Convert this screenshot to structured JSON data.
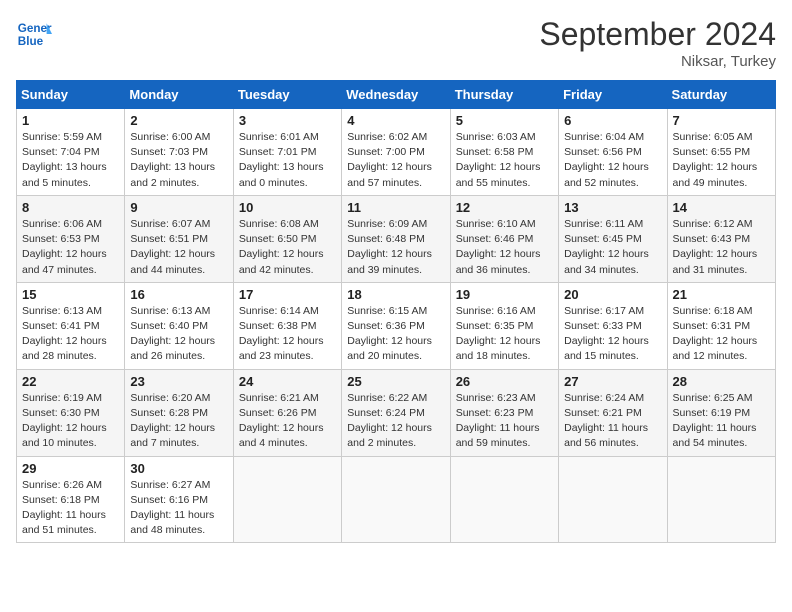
{
  "header": {
    "logo_line1": "General",
    "logo_line2": "Blue",
    "month": "September 2024",
    "location": "Niksar, Turkey"
  },
  "weekdays": [
    "Sunday",
    "Monday",
    "Tuesday",
    "Wednesday",
    "Thursday",
    "Friday",
    "Saturday"
  ],
  "weeks": [
    [
      {
        "day": "1",
        "info": "Sunrise: 5:59 AM\nSunset: 7:04 PM\nDaylight: 13 hours\nand 5 minutes."
      },
      {
        "day": "2",
        "info": "Sunrise: 6:00 AM\nSunset: 7:03 PM\nDaylight: 13 hours\nand 2 minutes."
      },
      {
        "day": "3",
        "info": "Sunrise: 6:01 AM\nSunset: 7:01 PM\nDaylight: 13 hours\nand 0 minutes."
      },
      {
        "day": "4",
        "info": "Sunrise: 6:02 AM\nSunset: 7:00 PM\nDaylight: 12 hours\nand 57 minutes."
      },
      {
        "day": "5",
        "info": "Sunrise: 6:03 AM\nSunset: 6:58 PM\nDaylight: 12 hours\nand 55 minutes."
      },
      {
        "day": "6",
        "info": "Sunrise: 6:04 AM\nSunset: 6:56 PM\nDaylight: 12 hours\nand 52 minutes."
      },
      {
        "day": "7",
        "info": "Sunrise: 6:05 AM\nSunset: 6:55 PM\nDaylight: 12 hours\nand 49 minutes."
      }
    ],
    [
      {
        "day": "8",
        "info": "Sunrise: 6:06 AM\nSunset: 6:53 PM\nDaylight: 12 hours\nand 47 minutes."
      },
      {
        "day": "9",
        "info": "Sunrise: 6:07 AM\nSunset: 6:51 PM\nDaylight: 12 hours\nand 44 minutes."
      },
      {
        "day": "10",
        "info": "Sunrise: 6:08 AM\nSunset: 6:50 PM\nDaylight: 12 hours\nand 42 minutes."
      },
      {
        "day": "11",
        "info": "Sunrise: 6:09 AM\nSunset: 6:48 PM\nDaylight: 12 hours\nand 39 minutes."
      },
      {
        "day": "12",
        "info": "Sunrise: 6:10 AM\nSunset: 6:46 PM\nDaylight: 12 hours\nand 36 minutes."
      },
      {
        "day": "13",
        "info": "Sunrise: 6:11 AM\nSunset: 6:45 PM\nDaylight: 12 hours\nand 34 minutes."
      },
      {
        "day": "14",
        "info": "Sunrise: 6:12 AM\nSunset: 6:43 PM\nDaylight: 12 hours\nand 31 minutes."
      }
    ],
    [
      {
        "day": "15",
        "info": "Sunrise: 6:13 AM\nSunset: 6:41 PM\nDaylight: 12 hours\nand 28 minutes."
      },
      {
        "day": "16",
        "info": "Sunrise: 6:13 AM\nSunset: 6:40 PM\nDaylight: 12 hours\nand 26 minutes."
      },
      {
        "day": "17",
        "info": "Sunrise: 6:14 AM\nSunset: 6:38 PM\nDaylight: 12 hours\nand 23 minutes."
      },
      {
        "day": "18",
        "info": "Sunrise: 6:15 AM\nSunset: 6:36 PM\nDaylight: 12 hours\nand 20 minutes."
      },
      {
        "day": "19",
        "info": "Sunrise: 6:16 AM\nSunset: 6:35 PM\nDaylight: 12 hours\nand 18 minutes."
      },
      {
        "day": "20",
        "info": "Sunrise: 6:17 AM\nSunset: 6:33 PM\nDaylight: 12 hours\nand 15 minutes."
      },
      {
        "day": "21",
        "info": "Sunrise: 6:18 AM\nSunset: 6:31 PM\nDaylight: 12 hours\nand 12 minutes."
      }
    ],
    [
      {
        "day": "22",
        "info": "Sunrise: 6:19 AM\nSunset: 6:30 PM\nDaylight: 12 hours\nand 10 minutes."
      },
      {
        "day": "23",
        "info": "Sunrise: 6:20 AM\nSunset: 6:28 PM\nDaylight: 12 hours\nand 7 minutes."
      },
      {
        "day": "24",
        "info": "Sunrise: 6:21 AM\nSunset: 6:26 PM\nDaylight: 12 hours\nand 4 minutes."
      },
      {
        "day": "25",
        "info": "Sunrise: 6:22 AM\nSunset: 6:24 PM\nDaylight: 12 hours\nand 2 minutes."
      },
      {
        "day": "26",
        "info": "Sunrise: 6:23 AM\nSunset: 6:23 PM\nDaylight: 11 hours\nand 59 minutes."
      },
      {
        "day": "27",
        "info": "Sunrise: 6:24 AM\nSunset: 6:21 PM\nDaylight: 11 hours\nand 56 minutes."
      },
      {
        "day": "28",
        "info": "Sunrise: 6:25 AM\nSunset: 6:19 PM\nDaylight: 11 hours\nand 54 minutes."
      }
    ],
    [
      {
        "day": "29",
        "info": "Sunrise: 6:26 AM\nSunset: 6:18 PM\nDaylight: 11 hours\nand 51 minutes."
      },
      {
        "day": "30",
        "info": "Sunrise: 6:27 AM\nSunset: 6:16 PM\nDaylight: 11 hours\nand 48 minutes."
      },
      null,
      null,
      null,
      null,
      null
    ]
  ]
}
